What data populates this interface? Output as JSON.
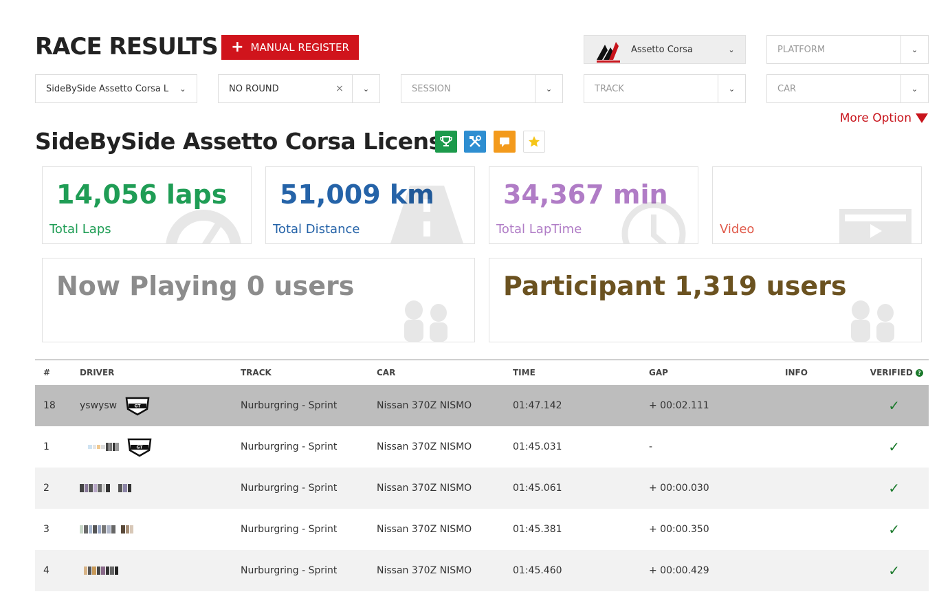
{
  "header": {
    "title": "RACE RESULTS",
    "manual_register": "MANUAL REGISTER",
    "game": "Assetto Corsa",
    "platform_placeholder": "PLATFORM"
  },
  "filters": {
    "league": "SideBySide Assetto Corsa Lic···",
    "round": "NO ROUND",
    "session": "SESSION",
    "track": "TRACK",
    "car": "CAR"
  },
  "more_option": "More Option",
  "league_title": "SideBySide Assetto Corsa License B",
  "badges": [
    {
      "name": "trophy-icon",
      "color": "#1c9a4b"
    },
    {
      "name": "tools-icon",
      "color": "#2e8ed1"
    },
    {
      "name": "chat-icon",
      "color": "#f39a1c"
    },
    {
      "name": "star-icon",
      "color": "#ffffff"
    }
  ],
  "stats": {
    "laps_value": "14,056 laps",
    "laps_label": "Total Laps",
    "distance_value": "51,009 km",
    "distance_label": "Total Distance",
    "laptime_value": "34,367 min",
    "laptime_label": "Total LapTime",
    "video_label": "Video",
    "now_playing": "Now Playing 0 users",
    "participant": "Participant 1,319 users"
  },
  "colors": {
    "laps": "#1f9d55",
    "distance": "#2563a8",
    "laptime": "#b07cc6",
    "video": "#e05a4a",
    "now_playing": "#8c8c8c",
    "participant": "#6b5220",
    "accent_red": "#d0141c"
  },
  "table": {
    "headers": {
      "num": "#",
      "driver": "DRIVER",
      "track": "TRACK",
      "car": "CAR",
      "time": "TIME",
      "gap": "GAP",
      "info": "INFO",
      "verified": "VERIFIED"
    },
    "rows": [
      {
        "num": "18",
        "driver": "yswysw",
        "track": "Nurburgring - Sprint",
        "car": "Nissan 370Z NISMO",
        "time": "01:47.142",
        "gap": "+ 00:02.111",
        "verified": "✓"
      },
      {
        "num": "1",
        "driver": "",
        "track": "Nurburgring - Sprint",
        "car": "Nissan 370Z NISMO",
        "time": "01:45.031",
        "gap": "-",
        "verified": "✓"
      },
      {
        "num": "2",
        "driver": "",
        "track": "Nurburgring - Sprint",
        "car": "Nissan 370Z NISMO",
        "time": "01:45.061",
        "gap": "+ 00:00.030",
        "verified": "✓"
      },
      {
        "num": "3",
        "driver": "",
        "track": "Nurburgring - Sprint",
        "car": "Nissan 370Z NISMO",
        "time": "01:45.381",
        "gap": "+ 00:00.350",
        "verified": "✓"
      },
      {
        "num": "4",
        "driver": "",
        "track": "Nurburgring - Sprint",
        "car": "Nissan 370Z NISMO",
        "time": "01:45.460",
        "gap": "+ 00:00.429",
        "verified": "✓"
      }
    ]
  }
}
